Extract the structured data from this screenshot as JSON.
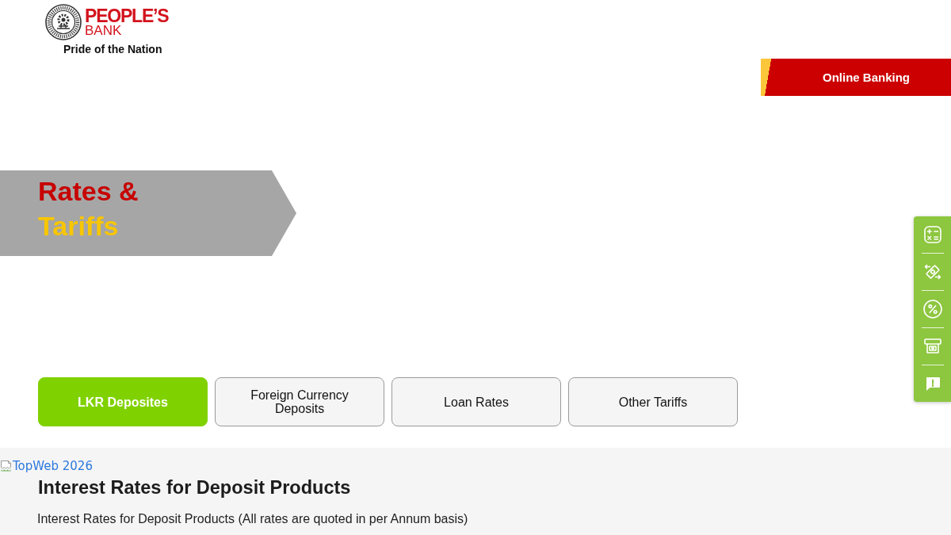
{
  "header": {
    "logo": {
      "wordmark_line_1": "PEOPLE’S",
      "wordmark_line_2": "BANK",
      "tagline": "Pride of the Nation"
    },
    "online_banking_button": "Online Banking"
  },
  "hero": {
    "title_line_1": "Rates &",
    "title_line_2": "Tariffs"
  },
  "tabs": [
    {
      "label": "LKR Deposites",
      "selected": true
    },
    {
      "label": "Foreign Currency Deposits",
      "selected": false
    },
    {
      "label": "Loan Rates",
      "selected": false
    },
    {
      "label": "Other Tariffs",
      "selected": false
    }
  ],
  "content": {
    "image_alt_text": "TopWeb 2026",
    "heading": "Interest Rates for Deposit Products",
    "description": "Interest Rates for Deposit Products (All rates are quoted in per Annum basis)"
  }
}
